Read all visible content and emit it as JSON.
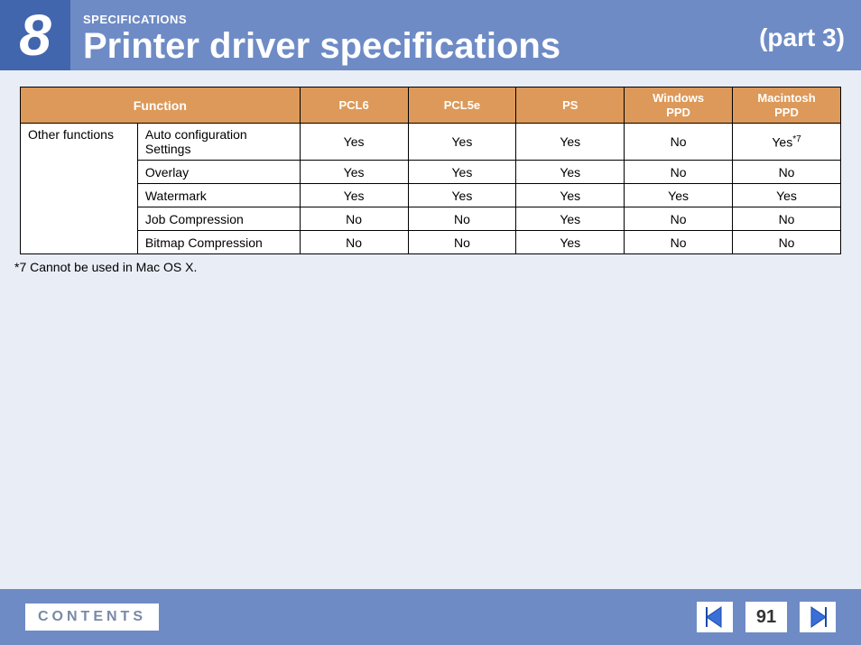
{
  "header": {
    "chapter_number": "8",
    "section_label": "SPECIFICATIONS",
    "title": "Printer driver specifications",
    "part": "(part 3)"
  },
  "table": {
    "headers": {
      "function": "Function",
      "col1": "PCL6",
      "col2": "PCL5e",
      "col3": "PS",
      "col4_line1": "Windows",
      "col4_line2": "PPD",
      "col5_line1": "Macintosh",
      "col5_line2": "PPD"
    },
    "category": "Other functions",
    "rows": [
      {
        "sub": "Auto configuration Settings",
        "v": [
          "Yes",
          "Yes",
          "Yes",
          "No",
          "Yes"
        ],
        "note5": "*7"
      },
      {
        "sub": "Overlay",
        "v": [
          "Yes",
          "Yes",
          "Yes",
          "No",
          "No"
        ]
      },
      {
        "sub": "Watermark",
        "v": [
          "Yes",
          "Yes",
          "Yes",
          "Yes",
          "Yes"
        ]
      },
      {
        "sub": "Job Compression",
        "v": [
          "No",
          "No",
          "Yes",
          "No",
          "No"
        ]
      },
      {
        "sub": "Bitmap Compression",
        "v": [
          "No",
          "No",
          "Yes",
          "No",
          "No"
        ]
      }
    ]
  },
  "footnote": "*7 Cannot be used in Mac OS X.",
  "footer": {
    "contents": "CONTENTS",
    "page_number": "91"
  }
}
